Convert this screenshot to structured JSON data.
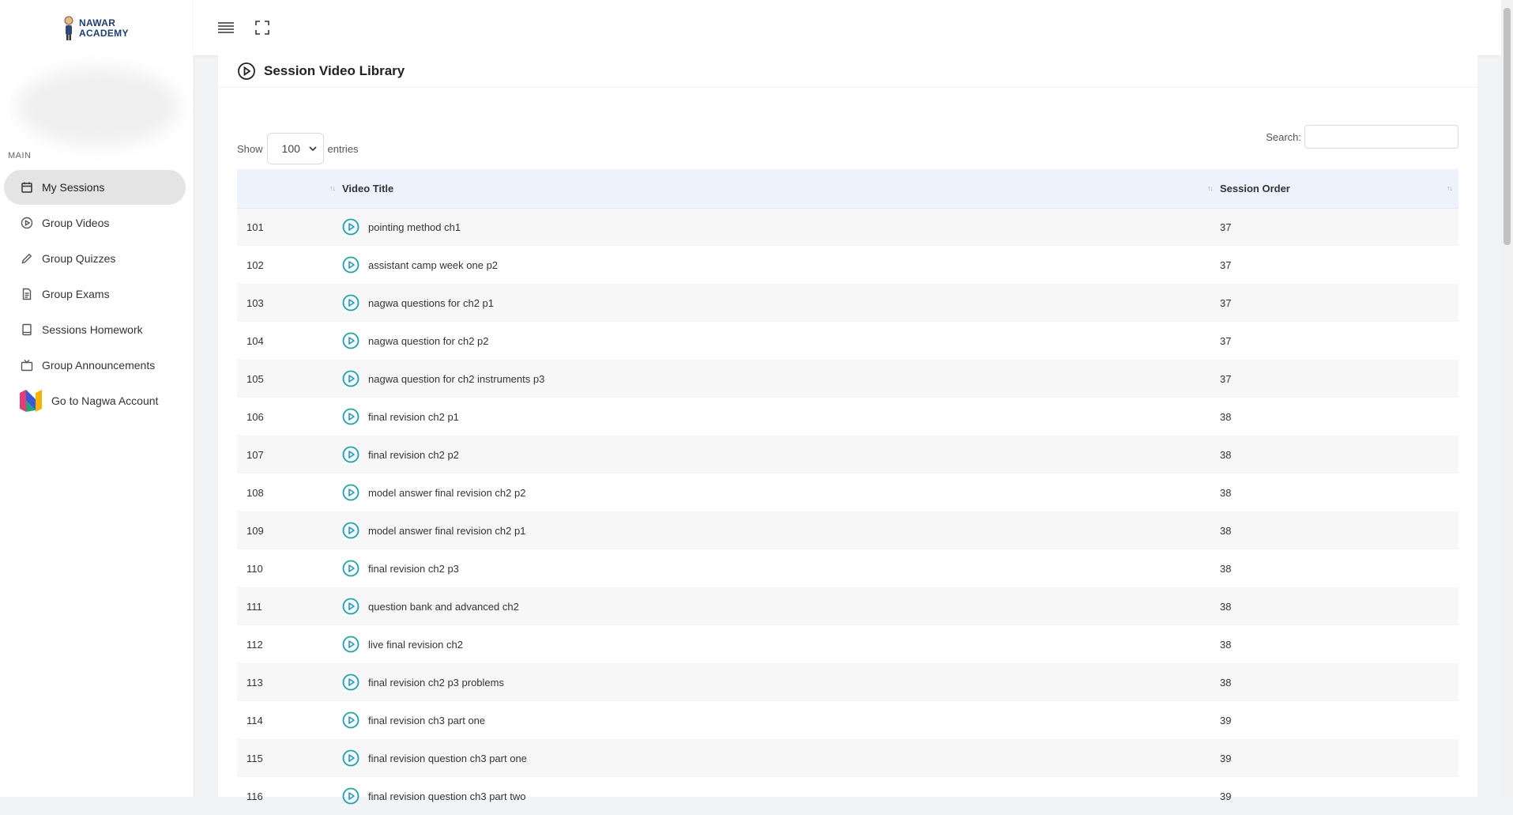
{
  "brand": {
    "line1": "NAWAR",
    "line2": "ACADEMY"
  },
  "sidebar": {
    "section_label": "MAIN",
    "items": [
      {
        "label": "My Sessions",
        "icon": "calendar-icon",
        "active": true
      },
      {
        "label": "Group Videos",
        "icon": "play-circle-icon"
      },
      {
        "label": "Group Quizzes",
        "icon": "pencil-icon"
      },
      {
        "label": "Group Exams",
        "icon": "document-icon"
      },
      {
        "label": "Sessions Homework",
        "icon": "book-icon"
      },
      {
        "label": "Group Announcements",
        "icon": "tv-icon"
      },
      {
        "label": "Go to Nagwa Account",
        "icon": "nagwa-logo-icon"
      }
    ]
  },
  "topbar": {
    "menu_icon": "hamburger-icon",
    "fullscreen_icon": "fullscreen-icon"
  },
  "page": {
    "title": "Session Video Library",
    "title_icon": "play-circle-icon"
  },
  "controls": {
    "show_label": "Show",
    "entries_value": "100",
    "entries_label": "entries",
    "search_label": "Search:",
    "search_value": ""
  },
  "table": {
    "headers": [
      "",
      "Video Title",
      "Session Order"
    ],
    "rows": [
      {
        "num": "101",
        "title": "pointing method ch1",
        "order": "37"
      },
      {
        "num": "102",
        "title": "assistant camp week one p2",
        "order": "37"
      },
      {
        "num": "103",
        "title": "nagwa questions for ch2 p1",
        "order": "37"
      },
      {
        "num": "104",
        "title": "nagwa question for ch2 p2",
        "order": "37"
      },
      {
        "num": "105",
        "title": "nagwa question for ch2 instruments p3",
        "order": "37"
      },
      {
        "num": "106",
        "title": "final revision ch2 p1",
        "order": "38"
      },
      {
        "num": "107",
        "title": "final revision ch2 p2",
        "order": "38"
      },
      {
        "num": "108",
        "title": "model answer final revision ch2 p2",
        "order": "38"
      },
      {
        "num": "109",
        "title": "model answer final revision ch2 p1",
        "order": "38"
      },
      {
        "num": "110",
        "title": "final revision ch2 p3",
        "order": "38"
      },
      {
        "num": "111",
        "title": "question bank and advanced ch2",
        "order": "38"
      },
      {
        "num": "112",
        "title": "live final revision ch2",
        "order": "38"
      },
      {
        "num": "113",
        "title": "final revision ch2 p3 problems",
        "order": "38"
      },
      {
        "num": "114",
        "title": "final revision ch3 part one",
        "order": "39"
      },
      {
        "num": "115",
        "title": "final revision question ch3 part one",
        "order": "39"
      },
      {
        "num": "116",
        "title": "final revision question ch3 part two",
        "order": "39"
      }
    ]
  },
  "colors": {
    "accent": "#17a2b8",
    "header_bg": "#eef2fd",
    "active_nav": "#e4e4e4"
  }
}
